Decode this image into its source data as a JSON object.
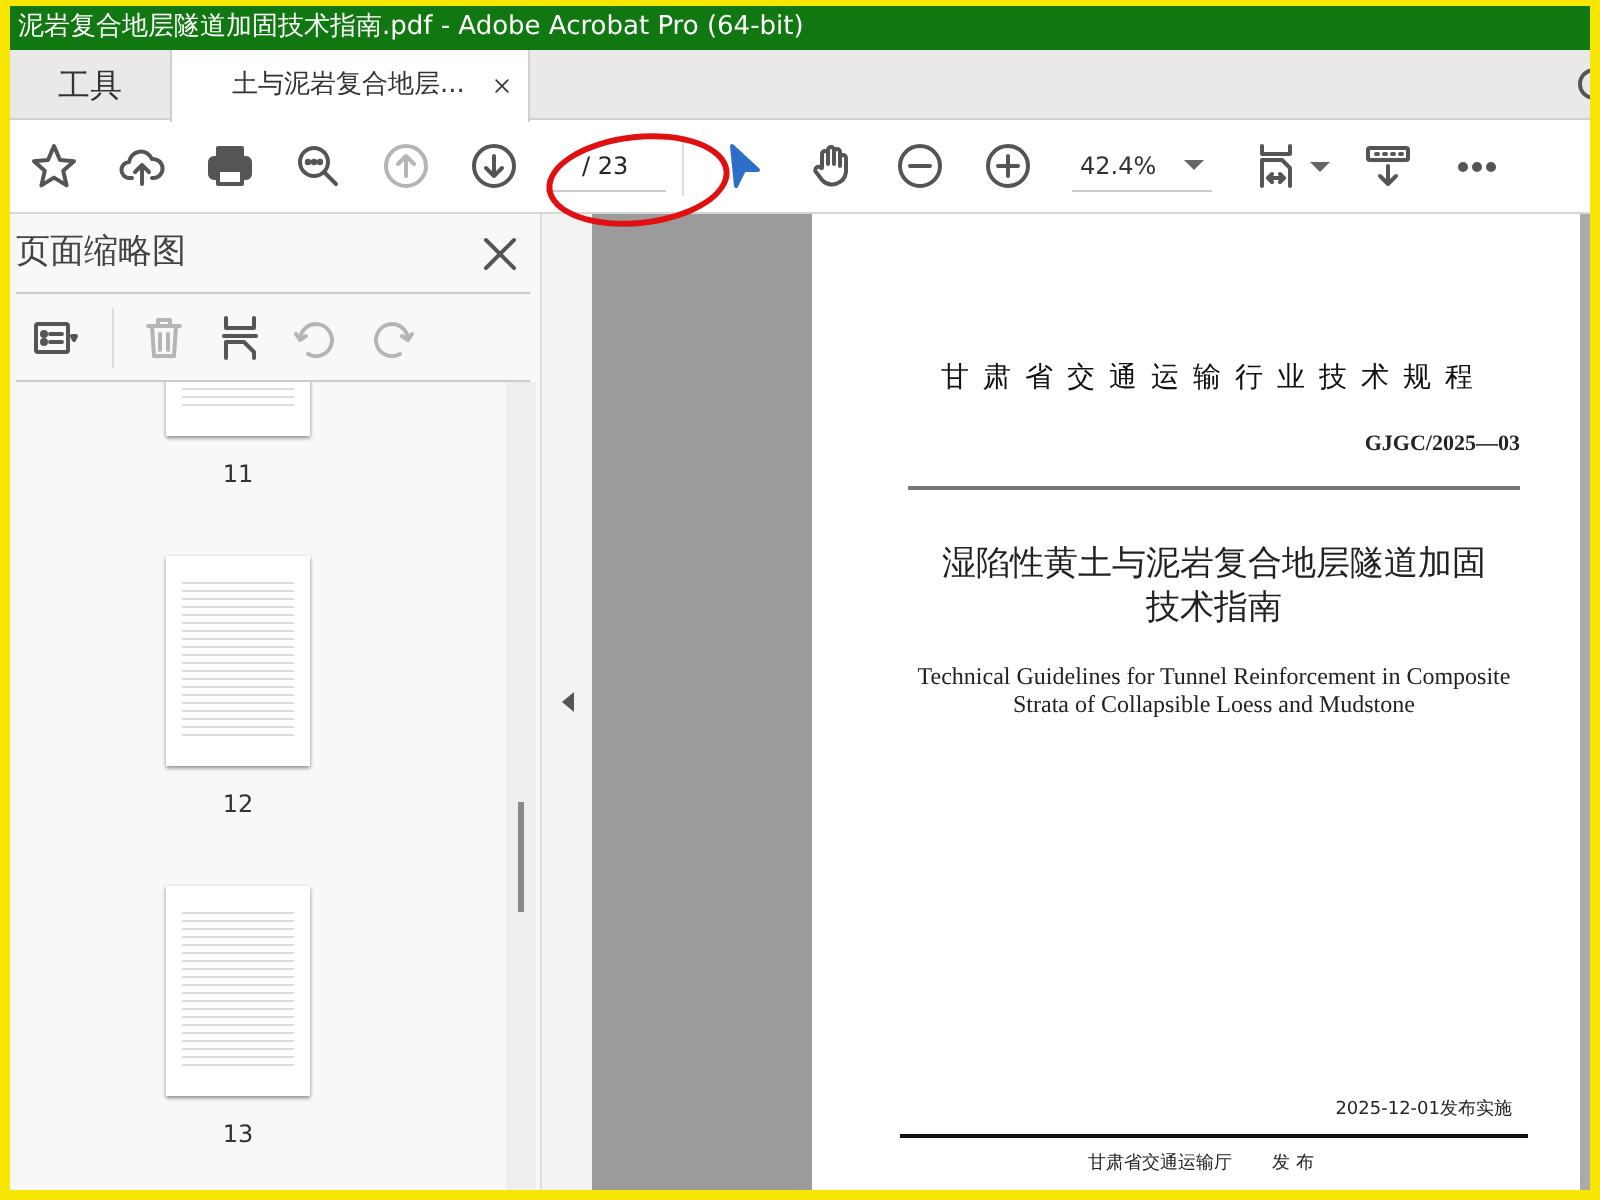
{
  "window": {
    "title": "泥岩复合地层隧道加固技术指南.pdf - Adobe Acrobat Pro (64-bit)"
  },
  "tabs": [
    {
      "label": "工具",
      "selected": false,
      "closable": false
    },
    {
      "label": "土与泥岩复合地层...",
      "selected": true,
      "closable": true
    }
  ],
  "toolbar": {
    "tools": [
      {
        "kind": "star",
        "disabled": false
      },
      {
        "kind": "upload",
        "disabled": false
      },
      {
        "kind": "print",
        "disabled": false
      },
      {
        "kind": "search",
        "disabled": false
      },
      {
        "kind": "prev",
        "disabled": true
      },
      {
        "kind": "next",
        "disabled": false
      }
    ],
    "page_total": "/ 23",
    "tools2": [
      {
        "kind": "pointer",
        "selected": true
      },
      {
        "kind": "hand",
        "selected": false
      },
      {
        "kind": "zoomout",
        "selected": false
      },
      {
        "kind": "zoomin",
        "selected": false
      }
    ],
    "zoom": "42.4%"
  },
  "sidebar": {
    "title": "页面缩略图",
    "tools": [
      {
        "kind": "options",
        "disabled": false
      },
      {
        "kind": "delete",
        "disabled": true
      },
      {
        "kind": "insert",
        "disabled": false
      },
      {
        "kind": "rotl",
        "disabled": true
      },
      {
        "kind": "rotr",
        "disabled": true
      }
    ],
    "thumbnails": [
      "11",
      "12",
      "13"
    ]
  },
  "document": {
    "header": "甘肃省交通运输行业技术规程",
    "code": "GJGC/2025—03",
    "title_lines": [
      "湿陷性黄土与泥岩复合地层隧道加固",
      "技术指南"
    ],
    "title_en": "Technical Guidelines for Tunnel Reinforcement in Composite Strata of Collapsible Loess and Mudstone",
    "effective": "2025-12-01发布实施",
    "issuer": "甘肃省交通运输厅",
    "issued": "发 布"
  }
}
